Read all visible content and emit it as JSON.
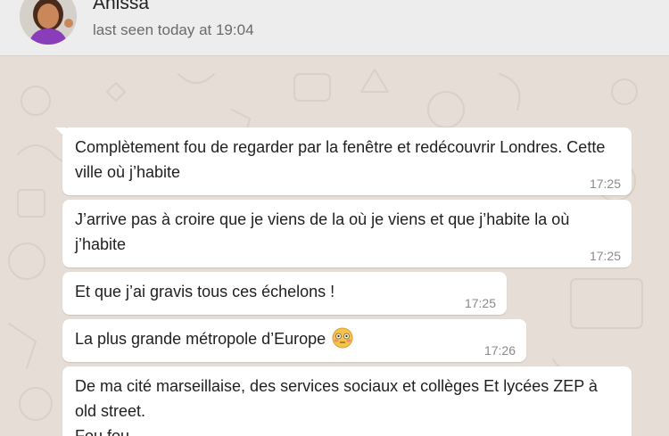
{
  "header": {
    "contact_name": "Anissa",
    "last_seen": "last seen today at 19:04",
    "avatar_icon": "person-emoji-avatar"
  },
  "messages": [
    {
      "text": "Complètement fou de regarder par la fenêtre et redécouvrir Londres. Cette ville où j’habite",
      "time": "17:25"
    },
    {
      "text": "J’arrive pas à croire que je viens de la où je viens et que j’habite la où j’habite",
      "time": "17:25"
    },
    {
      "text": "Et que j’ai gravis tous ces échelons !",
      "time": "17:25"
    },
    {
      "text": "La plus grande métropole d’Europe",
      "emoji": "flushed-face",
      "time": "17:26"
    },
    {
      "text": "De ma cité marseillaise, des services sociaux et collèges Et lycées ZEP à old street.",
      "text_cut": "Fou fou",
      "time": ""
    }
  ],
  "colors": {
    "background": "#e6ded6",
    "bubble": "#ffffff",
    "header": "#ededed"
  }
}
